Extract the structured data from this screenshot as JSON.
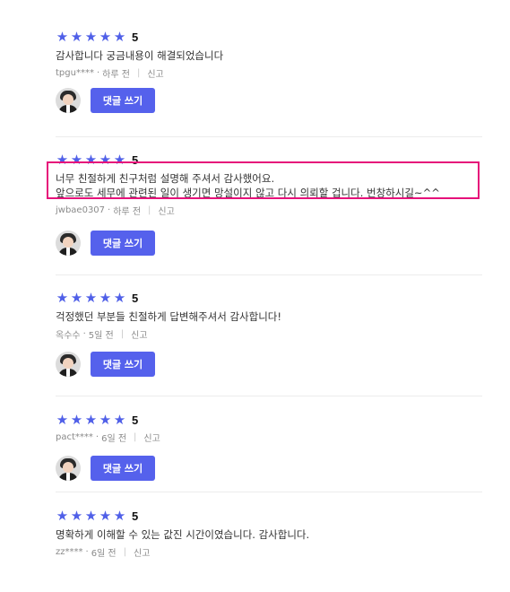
{
  "reviews": [
    {
      "stars": [
        "★",
        "★",
        "★",
        "★",
        "★"
      ],
      "score": "5",
      "text": "감사합니다 궁금내용이 해결되었습니다",
      "author": "tpgu****",
      "time": "하루 전",
      "report": "신고",
      "reply_label": "댓글 쓰기"
    },
    {
      "stars": [
        "★",
        "★",
        "★",
        "★",
        "★"
      ],
      "score": "5",
      "text": "너무 친절하게 친구처럼 설명해 주셔서 감사했어요.\n앞으로도 세무에 관련된 일이 생기면 망설이지 않고 다시 의뢰할 겁니다. 번창하시길~^^",
      "author": "jwbae0307",
      "time": "하루 전",
      "report": "신고",
      "reply_label": "댓글 쓰기"
    },
    {
      "stars": [
        "★",
        "★",
        "★",
        "★",
        "★"
      ],
      "score": "5",
      "text": "걱정했던 부분들 친절하게 답변해주셔서 감사합니다!",
      "author": "옥수수",
      "time": "5일 전",
      "report": "신고",
      "reply_label": "댓글 쓰기"
    },
    {
      "stars": [
        "★",
        "★",
        "★",
        "★",
        "★"
      ],
      "score": "5",
      "text": "",
      "author": "pact****",
      "time": "6일 전",
      "report": "신고",
      "reply_label": "댓글 쓰기"
    },
    {
      "stars": [
        "★",
        "★",
        "★",
        "★",
        "★"
      ],
      "score": "5",
      "text": "명확하게 이해할 수 있는 값진 시간이였습니다. 감사합니다.",
      "author": "zz****",
      "time": "6일 전",
      "report": "신고"
    }
  ],
  "meta_dot": "·",
  "meta_bar": "|",
  "colors": {
    "accent": "#5561ec",
    "star": "#4f5fe8",
    "highlight": "#e6127a"
  }
}
